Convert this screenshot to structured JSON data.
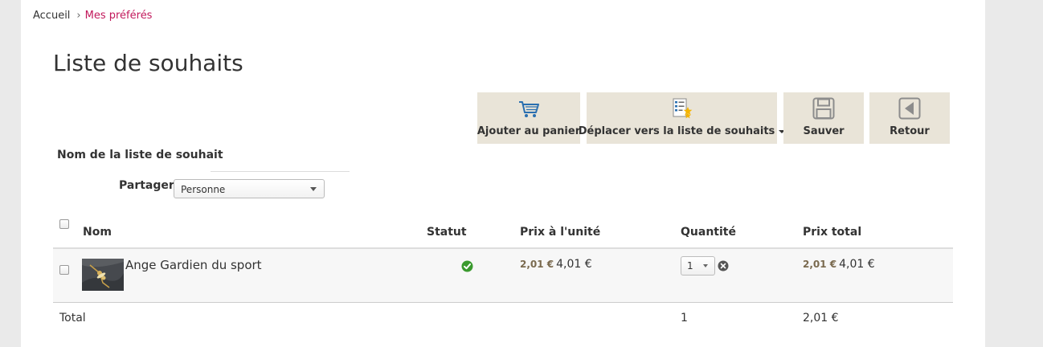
{
  "breadcrumb": {
    "home": "Accueil",
    "separator": "›",
    "current": "Mes préférés"
  },
  "page": {
    "title": "Liste de souhaits"
  },
  "toolbar": {
    "add_to_cart": "Ajouter au panier",
    "move_to_wishlist": "Déplacer vers la liste de souhaits",
    "save": "Sauver",
    "back": "Retour"
  },
  "form": {
    "name_label": "Nom de la liste de souhait",
    "name_value": "",
    "share_label": "Partager",
    "share_selected": "Personne"
  },
  "table": {
    "headers": {
      "name": "Nom",
      "status": "Statut",
      "unit_price": "Prix à l'unité",
      "quantity": "Quantité",
      "total_price": "Prix total"
    },
    "rows": [
      {
        "name": "Ange Gardien du sport",
        "status_icon": "check-circle-icon",
        "unit_price_old": "2,01 €",
        "unit_price": "4,01 €",
        "quantity": "1",
        "total_price_old": "2,01 €",
        "total_price": "4,01 €"
      }
    ],
    "footer": {
      "label": "Total",
      "quantity": "1",
      "total": "2,01 €"
    }
  },
  "colors": {
    "accent": "#c2185b",
    "button_bg": "#e9e4d8",
    "status_ok": "#3a9a2e"
  }
}
